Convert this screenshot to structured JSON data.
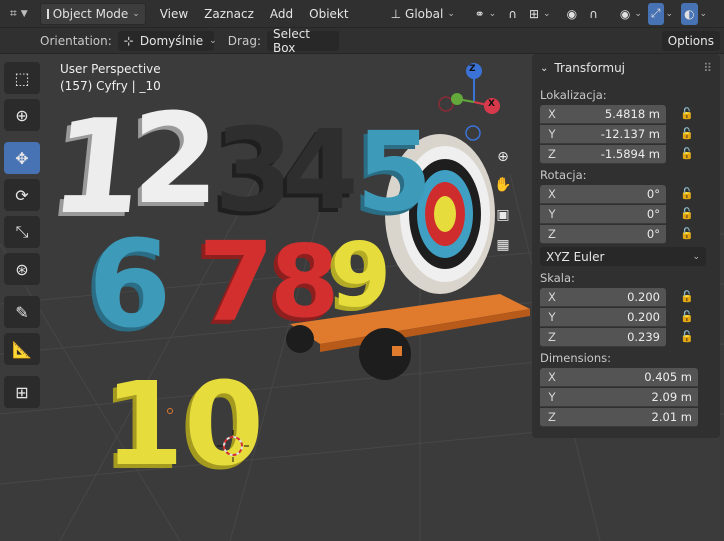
{
  "header": {
    "editor_icon": "globe-editor-type-icon",
    "mode_label": "Object Mode",
    "menus": [
      "View",
      "Zaznacz",
      "Add",
      "Obiekt"
    ],
    "orientation_label": "Global"
  },
  "tool_settings": {
    "orientation_label": "Orientation:",
    "orientation_value": "Domyślnie",
    "drag_label": "Drag:",
    "drag_value": "Select Box",
    "options_label": "Options"
  },
  "viewport": {
    "view_name": "User Perspective",
    "object_info": "(157) Cyfry | _10",
    "gizmo": {
      "z": "Z",
      "x": "X"
    },
    "digits_row1": "12345",
    "digits_row2": "6789",
    "digits_row3": "10",
    "colors": {
      "white": "#ececec",
      "black": "#2b2b2b",
      "blue": "#3d9ab8",
      "red": "#d32f2f",
      "yellow": "#e6dc3c",
      "orange": "#e06b1e",
      "accent": "#4772b3"
    }
  },
  "panel": {
    "title": "Transformuj",
    "location_label": "Lokalizacja:",
    "location": [
      {
        "axis": "X",
        "value": "5.4818 m"
      },
      {
        "axis": "Y",
        "value": "-12.137 m"
      },
      {
        "axis": "Z",
        "value": "-1.5894 m"
      }
    ],
    "rotation_label": "Rotacja:",
    "rotation": [
      {
        "axis": "X",
        "value": "0°"
      },
      {
        "axis": "Y",
        "value": "0°"
      },
      {
        "axis": "Z",
        "value": "0°"
      }
    ],
    "rotation_mode": "XYZ Euler",
    "scale_label": "Skala:",
    "scale": [
      {
        "axis": "X",
        "value": "0.200"
      },
      {
        "axis": "Y",
        "value": "0.200"
      },
      {
        "axis": "Z",
        "value": "0.239"
      }
    ],
    "dimensions_label": "Dimensions:",
    "dimensions": [
      {
        "axis": "X",
        "value": "0.405 m"
      },
      {
        "axis": "Y",
        "value": "2.09 m"
      },
      {
        "axis": "Z",
        "value": "2.01 m"
      }
    ]
  }
}
